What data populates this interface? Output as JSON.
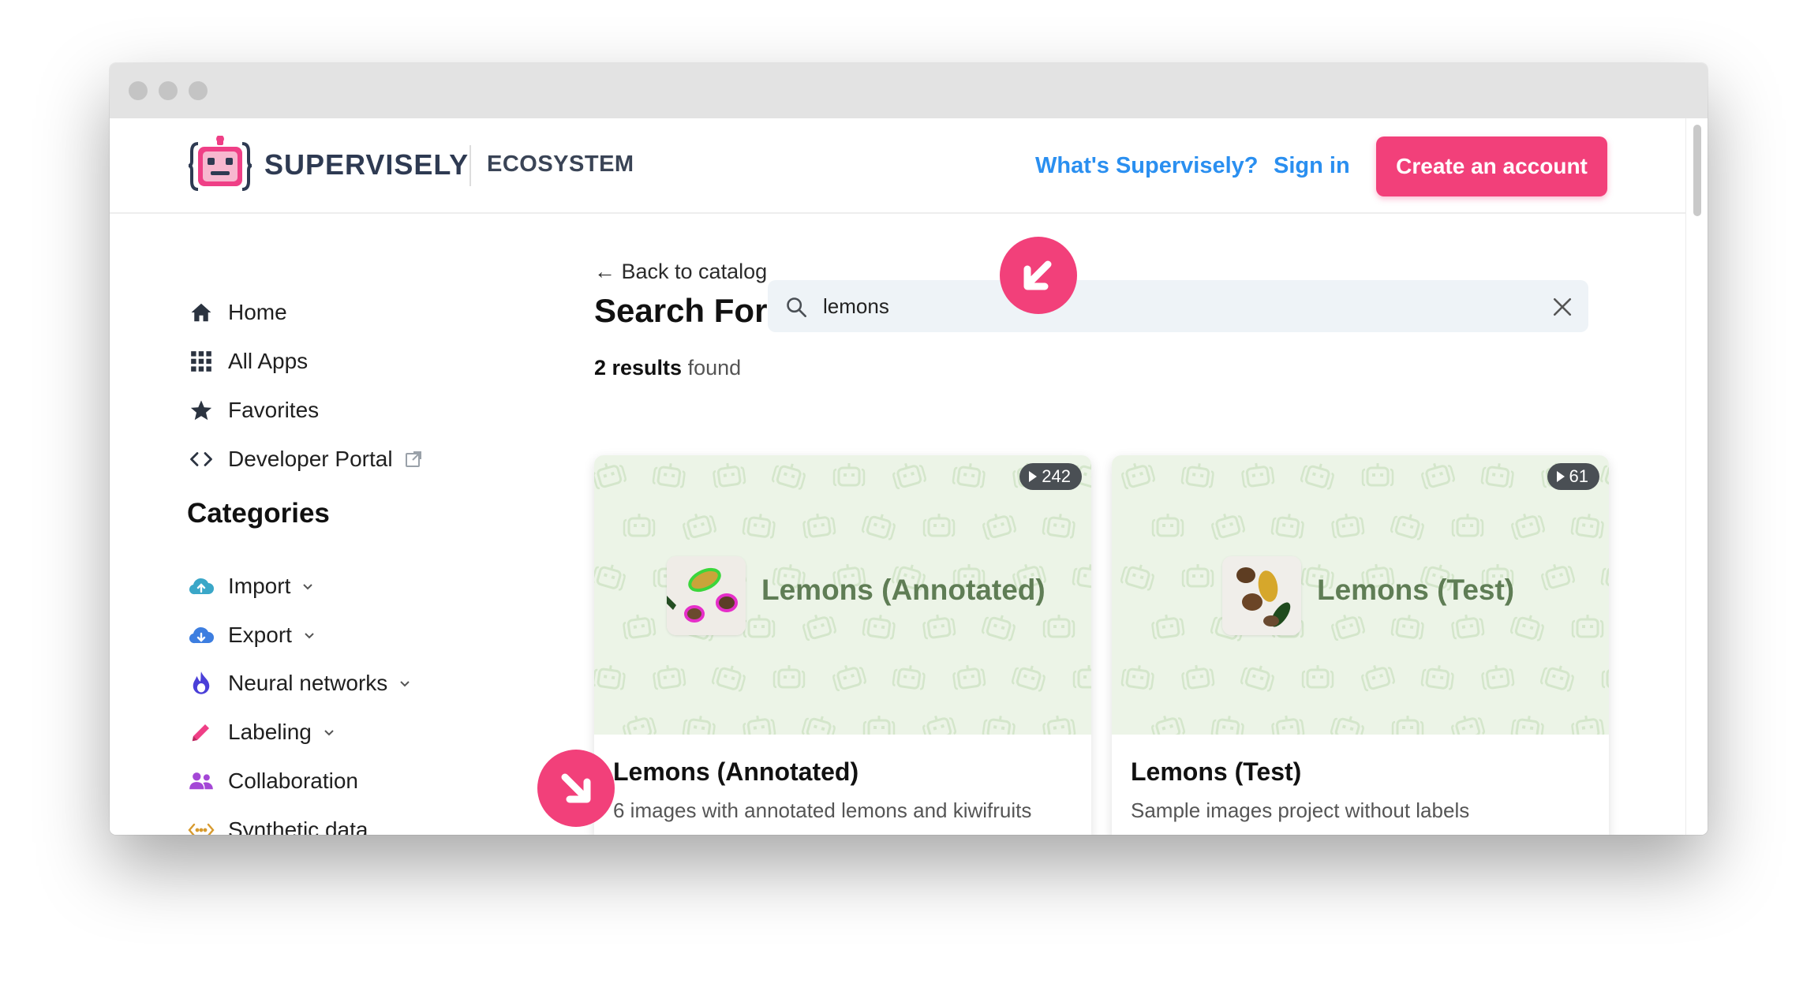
{
  "header": {
    "brand": "SUPERVISELY",
    "section": "ECOSYSTEM",
    "nav_what": "What's Supervisely?",
    "nav_sign_in": "Sign in",
    "create_account": "Create an account"
  },
  "sidebar": {
    "items": [
      {
        "label": "Home",
        "icon": "home-icon"
      },
      {
        "label": "All Apps",
        "icon": "grid-icon"
      },
      {
        "label": "Favorites",
        "icon": "star-icon"
      },
      {
        "label": "Developer Portal",
        "icon": "code-icon"
      }
    ],
    "categories_title": "Categories",
    "categories": [
      {
        "label": "Import",
        "icon": "cloud-upload-icon",
        "color": "#3aa7c8"
      },
      {
        "label": "Export",
        "icon": "cloud-download-icon",
        "color": "#3d7ee0"
      },
      {
        "label": "Neural networks",
        "icon": "flame-icon",
        "color": "#4a3fd8"
      },
      {
        "label": "Labeling",
        "icon": "pencil-icon",
        "color": "#ef3f86"
      },
      {
        "label": "Collaboration",
        "icon": "people-icon",
        "color": "#a447d6"
      },
      {
        "label": "Synthetic data",
        "icon": "code-dots-icon",
        "color": "#d79a2e"
      }
    ]
  },
  "main": {
    "back_link": "← Back to catalog",
    "search_label": "Search For",
    "search_value": "lemons",
    "results_count": "2 results",
    "results_suffix": " found",
    "cards": [
      {
        "banner_title": "Lemons (Annotated)",
        "badge": "242",
        "title": "Lemons (Annotated)",
        "description": "6 images with annotated lemons and kiwifruits"
      },
      {
        "banner_title": "Lemons (Test)",
        "badge": "61",
        "title": "Lemons (Test)",
        "description": "Sample images project without labels"
      }
    ]
  },
  "colors": {
    "accent": "#f2407a",
    "link": "#2a8ff0",
    "banner_bg": "#ecf4e7",
    "banner_text": "#5f7d55"
  }
}
